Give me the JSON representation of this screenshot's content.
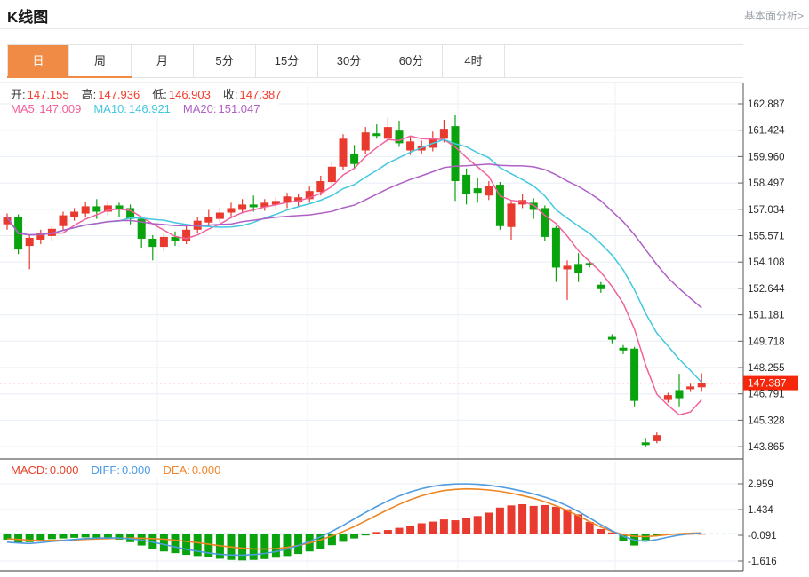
{
  "header": {
    "title": "K线图",
    "link": "基本面分析>"
  },
  "tabs": {
    "items": [
      "日",
      "周",
      "月",
      "5分",
      "15分",
      "30分",
      "60分",
      "4时"
    ],
    "selected_index": 0
  },
  "info_bar": {
    "items": [
      {
        "label": "开:",
        "value": "147.155"
      },
      {
        "label": "高:",
        "value": "147.936"
      },
      {
        "label": "低:",
        "value": "146.903"
      },
      {
        "label": "收:",
        "value": "147.387"
      }
    ],
    "value_color": "#f53b2b"
  },
  "ma_legend": {
    "items": [
      {
        "label": "MA5:",
        "value": "147.009",
        "color": "#f2619b"
      },
      {
        "label": "MA10:",
        "value": "146.921",
        "color": "#42c8e0"
      },
      {
        "label": "MA20:",
        "value": "151.047",
        "color": "#b05fc6"
      }
    ]
  },
  "macd_legend": {
    "items": [
      {
        "label": "MACD:",
        "value": "0.000",
        "color": "#e6442c"
      },
      {
        "label": "DIFF:",
        "value": "0.000",
        "color": "#4a9ce8"
      },
      {
        "label": "DEA:",
        "value": "0.000",
        "color": "#f0862c"
      }
    ]
  },
  "chart_data": {
    "type": "candlestick+macd",
    "title": "K线图 日线",
    "legend_position": "top-left overlay",
    "grid": true,
    "price_axis": {
      "ticks": [
        "162.887",
        "161.424",
        "159.960",
        "158.497",
        "157.034",
        "155.571",
        "154.108",
        "152.644",
        "151.181",
        "149.718",
        "148.255",
        "146.791",
        "145.328",
        "143.865"
      ],
      "min": 143.865,
      "max": 162.887
    },
    "current_price": 147.387,
    "current_price_label": "147.387",
    "ma_periods": [
      5,
      10,
      20
    ],
    "candles_format": [
      "open",
      "high",
      "low",
      "close"
    ],
    "candles": [
      [
        156.2,
        156.8,
        155.9,
        156.6
      ],
      [
        156.6,
        156.75,
        154.55,
        154.8
      ],
      [
        155.0,
        155.6,
        153.7,
        155.45
      ],
      [
        155.35,
        155.9,
        155.1,
        155.7
      ],
      [
        155.55,
        156.1,
        155.3,
        155.95
      ],
      [
        156.1,
        156.9,
        155.9,
        156.7
      ],
      [
        156.6,
        157.1,
        156.4,
        156.9
      ],
      [
        156.8,
        157.45,
        156.6,
        157.2
      ],
      [
        157.2,
        157.6,
        156.5,
        156.9
      ],
      [
        156.9,
        157.5,
        156.7,
        157.25
      ],
      [
        157.25,
        157.4,
        156.6,
        157.0
      ],
      [
        157.1,
        157.3,
        156.2,
        156.5
      ],
      [
        156.5,
        156.6,
        154.9,
        155.4
      ],
      [
        155.4,
        155.6,
        154.2,
        154.95
      ],
      [
        154.95,
        155.7,
        154.7,
        155.5
      ],
      [
        155.5,
        155.8,
        155.0,
        155.3
      ],
      [
        155.3,
        156.1,
        155.1,
        155.9
      ],
      [
        155.9,
        156.6,
        155.7,
        156.4
      ],
      [
        156.3,
        157.0,
        156.1,
        156.6
      ],
      [
        156.5,
        157.1,
        156.3,
        156.85
      ],
      [
        156.85,
        157.4,
        156.6,
        157.1
      ],
      [
        157.0,
        157.6,
        156.8,
        157.3
      ],
      [
        157.3,
        157.8,
        156.9,
        157.15
      ],
      [
        157.15,
        157.6,
        156.95,
        157.4
      ],
      [
        157.3,
        157.7,
        157.0,
        157.5
      ],
      [
        157.4,
        157.95,
        157.1,
        157.75
      ],
      [
        157.45,
        157.9,
        157.2,
        157.7
      ],
      [
        157.6,
        158.3,
        157.4,
        158.05
      ],
      [
        158.0,
        158.9,
        157.8,
        158.6
      ],
      [
        158.55,
        159.7,
        158.35,
        159.4
      ],
      [
        159.4,
        161.2,
        159.2,
        160.95
      ],
      [
        160.1,
        160.6,
        159.3,
        159.55
      ],
      [
        160.3,
        161.6,
        160.1,
        161.3
      ],
      [
        161.25,
        161.75,
        160.95,
        161.1
      ],
      [
        160.95,
        162.1,
        160.75,
        161.6
      ],
      [
        161.4,
        161.95,
        160.5,
        160.7
      ],
      [
        160.3,
        161.1,
        160.05,
        160.8
      ],
      [
        160.3,
        160.85,
        160.1,
        160.55
      ],
      [
        160.45,
        161.35,
        160.25,
        161.0
      ],
      [
        160.95,
        162.0,
        160.75,
        161.5
      ],
      [
        161.65,
        162.25,
        157.5,
        158.6
      ],
      [
        158.95,
        159.3,
        157.3,
        157.9
      ],
      [
        158.2,
        158.8,
        157.4,
        157.95
      ],
      [
        157.8,
        158.6,
        157.55,
        158.35
      ],
      [
        158.4,
        158.55,
        155.9,
        156.1
      ],
      [
        156.05,
        157.5,
        155.35,
        157.35
      ],
      [
        157.3,
        157.9,
        157.1,
        157.55
      ],
      [
        157.4,
        157.65,
        156.5,
        157.0
      ],
      [
        157.1,
        157.25,
        155.3,
        155.5
      ],
      [
        156.0,
        156.1,
        153.0,
        153.8
      ],
      [
        153.7,
        154.2,
        152.0,
        153.9
      ],
      [
        154.0,
        154.6,
        153.0,
        153.5
      ],
      [
        154.05,
        154.15,
        153.8,
        153.95
      ],
      [
        152.85,
        153.0,
        152.4,
        152.6
      ],
      [
        149.95,
        150.1,
        149.6,
        149.8
      ],
      [
        149.35,
        149.5,
        149.0,
        149.2
      ],
      [
        149.3,
        149.4,
        146.1,
        146.4
      ],
      [
        144.1,
        144.35,
        143.87,
        143.95
      ],
      [
        144.17,
        144.65,
        144.05,
        144.5
      ],
      [
        146.45,
        146.85,
        146.3,
        146.72
      ],
      [
        147.0,
        147.9,
        146.1,
        146.55
      ],
      [
        147.05,
        147.35,
        146.9,
        147.2
      ],
      [
        147.155,
        147.936,
        146.903,
        147.387
      ]
    ],
    "macd": {
      "axis_ticks": [
        "2.959",
        "1.434",
        "-0.091",
        "-1.616"
      ],
      "hist": [
        -0.35,
        -0.55,
        -0.5,
        -0.4,
        -0.32,
        -0.28,
        -0.24,
        -0.22,
        -0.25,
        -0.28,
        -0.35,
        -0.5,
        -0.7,
        -0.9,
        -1.05,
        -1.15,
        -1.25,
        -1.32,
        -1.4,
        -1.48,
        -1.55,
        -1.58,
        -1.55,
        -1.5,
        -1.42,
        -1.32,
        -1.2,
        -1.05,
        -0.88,
        -0.68,
        -0.48,
        -0.28,
        -0.1,
        0.1,
        0.22,
        0.35,
        0.48,
        0.62,
        0.72,
        0.85,
        0.8,
        0.92,
        1.05,
        1.25,
        1.55,
        1.68,
        1.75,
        1.65,
        1.7,
        1.6,
        1.45,
        1.15,
        0.7,
        0.28,
        0.08,
        -0.45,
        -0.7,
        -0.38,
        -0.1,
        -0.03,
        -0.01,
        0.0,
        0.0
      ],
      "diff": [
        -0.5,
        -0.55,
        -0.58,
        -0.52,
        -0.46,
        -0.4,
        -0.34,
        -0.29,
        -0.26,
        -0.25,
        -0.26,
        -0.3,
        -0.38,
        -0.5,
        -0.64,
        -0.78,
        -0.92,
        -1.04,
        -1.14,
        -1.22,
        -1.26,
        -1.27,
        -1.24,
        -1.17,
        -1.06,
        -0.9,
        -0.7,
        -0.46,
        -0.18,
        0.14,
        0.5,
        0.88,
        1.26,
        1.62,
        1.95,
        2.24,
        2.48,
        2.67,
        2.81,
        2.9,
        2.95,
        2.96,
        2.93,
        2.87,
        2.78,
        2.66,
        2.52,
        2.36,
        2.17,
        1.94,
        1.66,
        1.32,
        0.94,
        0.54,
        0.18,
        -0.15,
        -0.38,
        -0.45,
        -0.35,
        -0.2,
        -0.08,
        0.0,
        0.03
      ],
      "dea": [
        -0.3,
        -0.34,
        -0.38,
        -0.4,
        -0.4,
        -0.39,
        -0.37,
        -0.34,
        -0.31,
        -0.29,
        -0.27,
        -0.26,
        -0.27,
        -0.29,
        -0.33,
        -0.38,
        -0.45,
        -0.53,
        -0.62,
        -0.71,
        -0.79,
        -0.86,
        -0.9,
        -0.91,
        -0.88,
        -0.81,
        -0.7,
        -0.55,
        -0.36,
        -0.13,
        0.13,
        0.43,
        0.76,
        1.1,
        1.43,
        1.74,
        2.02,
        2.25,
        2.43,
        2.56,
        2.63,
        2.66,
        2.64,
        2.59,
        2.51,
        2.4,
        2.26,
        2.1,
        1.9,
        1.66,
        1.38,
        1.06,
        0.72,
        0.4,
        0.14,
        -0.05,
        -0.15,
        -0.17,
        -0.12,
        -0.05,
        0.0,
        0.03,
        0.05
      ]
    },
    "colors": {
      "up": "#e83a2e",
      "down": "#09a30e",
      "ma5": "#f2619b",
      "ma10": "#42c8e0",
      "ma20": "#b05fc6",
      "diff_line": "#4f9be0",
      "dea_line": "#ef8522",
      "current_price_bg": "#f5260a",
      "accent_tab": "#ef8b45",
      "grid": "#e8eef5",
      "axis_line": "#555555"
    }
  }
}
